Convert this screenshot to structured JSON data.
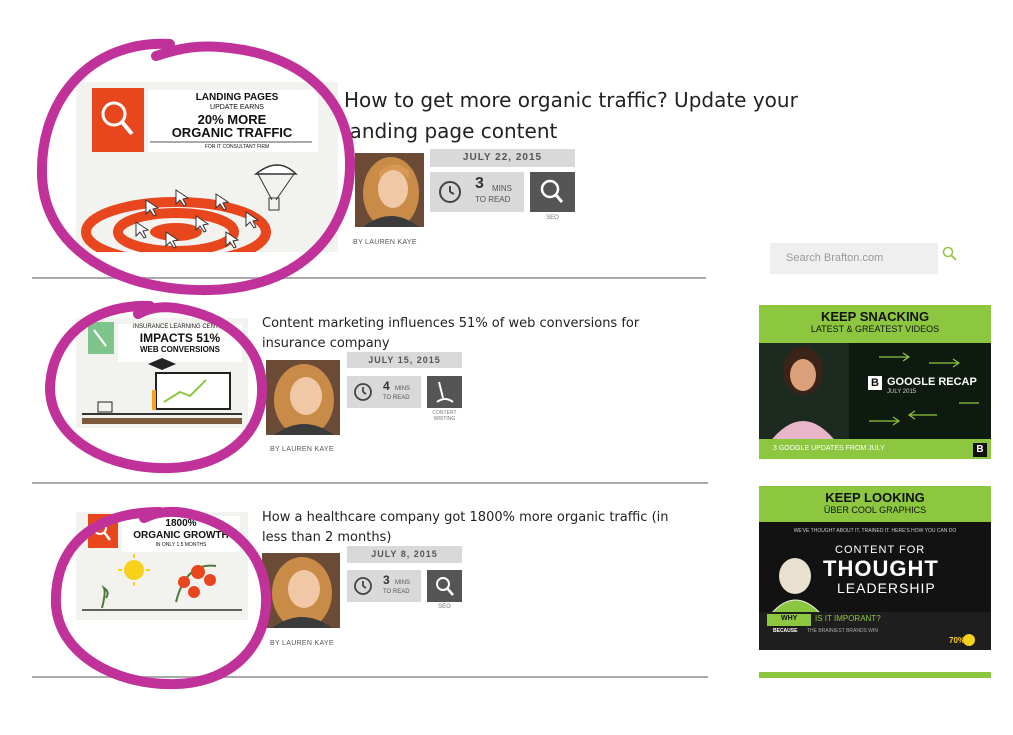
{
  "articles": [
    {
      "title": "How to get more organic traffic? Update your landing page content",
      "date": "JULY 22, 2015",
      "read_num": "3",
      "read_mins": "MINS",
      "read_to": "TO READ",
      "category": "SEO",
      "byline": "BY LAUREN KAYE",
      "thumb": {
        "line1": "LANDING PAGES",
        "line2": "UPDATE EARNS",
        "line3": "20% MORE",
        "line4": "ORGANIC TRAFFIC",
        "line5": "FOR IT CONSULTANT FIRM"
      }
    },
    {
      "title": "Content marketing influences 51% of web conversions for insurance company",
      "date": "JULY 15, 2015",
      "read_num": "4",
      "read_mins": "MINS",
      "read_to": "TO READ",
      "category": "CONTENT WRITING",
      "byline": "BY LAUREN KAYE",
      "thumb": {
        "line1": "INSURANCE LEARNING CENTER",
        "line2": "IMPACTS 51%",
        "line3": "WEB CONVERSIONS"
      }
    },
    {
      "title": "How a healthcare company got 1800% more organic traffic (in less than 2 months)",
      "date": "JULY 8, 2015",
      "read_num": "3",
      "read_mins": "MINS",
      "read_to": "TO READ",
      "category": "SEO",
      "byline": "BY LAUREN KAYE",
      "thumb": {
        "line1": "1800%",
        "line2": "ORGANIC GROWTH",
        "line3": "IN ONLY 1.5 MONTHS"
      }
    }
  ],
  "sidebar": {
    "search_placeholder": "Search Brafton.com",
    "promo1": {
      "title": "KEEP SNACKING",
      "subtitle": "LATEST & GREATEST VIDEOS",
      "video_title": "GOOGLE RECAP",
      "video_date": "JULY 2015",
      "caption": "3 GOOGLE UPDATES FROM JULY",
      "logo": "B"
    },
    "promo2": {
      "title": "KEEP LOOKING",
      "subtitle": "ÜBER COOL GRAPHICS",
      "intro": "WE'VE THOUGHT ABOUT IT, TRAINED IT. HERE'S HOW YOU CAN DO",
      "line1": "CONTENT FOR",
      "line2": "THOUGHT",
      "line3": "LEADERSHIP",
      "why": "WHY",
      "important": "IS IT IMPORANT?",
      "because": "BECAUSE",
      "brainiest": "THE BRAINIEST BRANDS WIN",
      "stat": "70%"
    }
  },
  "colors": {
    "highlight": "#c0329a",
    "accent": "#e8471e",
    "green": "#8dc63f",
    "teal": "#7fc48a"
  }
}
